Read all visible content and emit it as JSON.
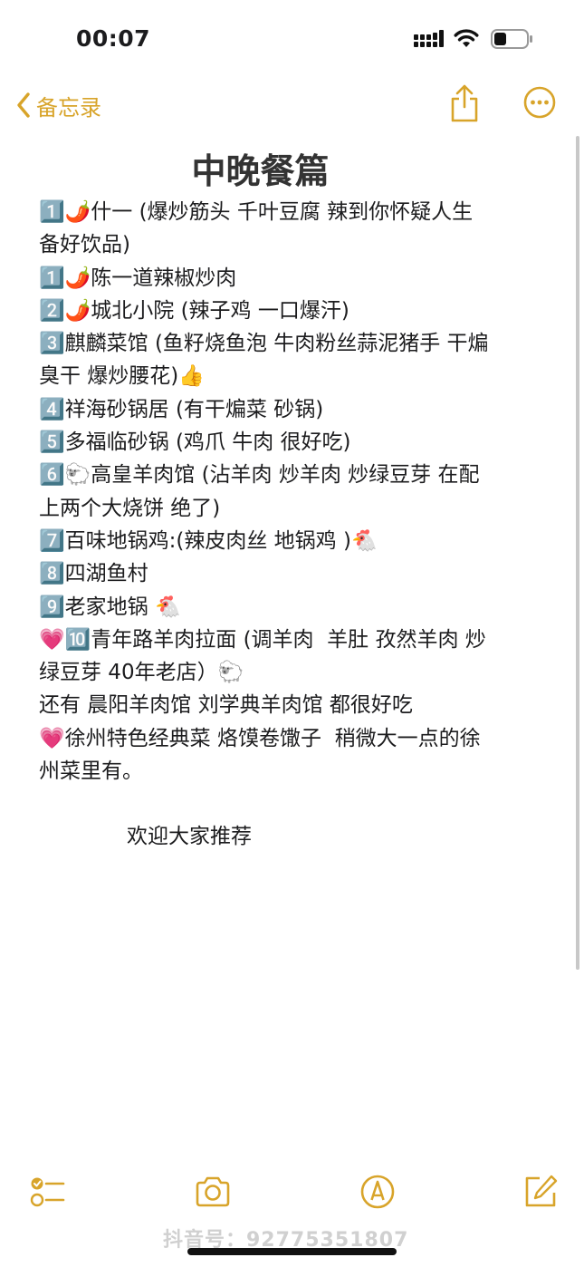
{
  "status_bar": {
    "time": "00:07"
  },
  "nav": {
    "back_label": "备忘录",
    "share_icon": "share-icon",
    "more_icon": "ellipsis-circle-icon",
    "accent_color": "#d8a42a"
  },
  "watermark_top": "",
  "note": {
    "title": "中晚餐篇",
    "lines": [
      "1️⃣🌶️什一 (爆炒筋头 千叶豆腐 辣到你怀疑人生",
      "备好饮品)",
      "1️⃣🌶️陈一道辣椒炒肉",
      "2️⃣🌶️城北小院 (辣子鸡 一口爆汗)",
      "3️⃣麒麟菜馆 (鱼籽烧鱼泡 牛肉粉丝蒜泥猪手 干煸",
      "臭干 爆炒腰花)👍",
      "4️⃣祥海砂锅居 (有干煸菜 砂锅)",
      "5️⃣多福临砂锅 (鸡爪 牛肉 很好吃)",
      "6️⃣🐑高皇羊肉馆 (沾羊肉 炒羊肉 炒绿豆芽 在配",
      "上两个大烧饼 绝了)",
      "7️⃣百味地锅鸡:(辣皮肉丝 地锅鸡 )🐔",
      "8️⃣四湖鱼村",
      "9️⃣老家地锅 🐔",
      "💗🔟青年路羊肉拉面 (调羊肉  羊肚 孜然羊肉 炒",
      "绿豆芽 40年老店）🐑",
      "还有 晨阳羊肉馆 刘学典羊肉馆 都很好吃",
      "💗徐州特色经典菜 烙馍卷馓子  稍微大一点的徐",
      "州菜里有。"
    ],
    "closing": "欢迎大家推荐"
  },
  "toolbar": {
    "icons": [
      "checklist-icon",
      "camera-icon",
      "markup-pen-icon",
      "compose-icon"
    ]
  },
  "watermark_bottom": "抖音号：92775351807"
}
